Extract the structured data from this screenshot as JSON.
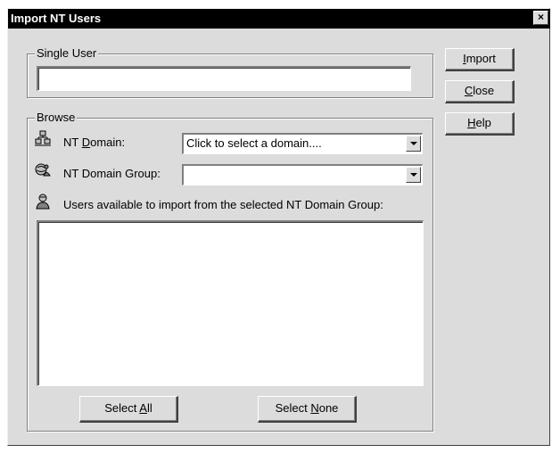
{
  "window": {
    "title": "Import NT Users",
    "close_symbol": "×"
  },
  "single_user": {
    "group_label": "Single User",
    "value": ""
  },
  "browse": {
    "group_label": "Browse",
    "domain_label_pre": "NT ",
    "domain_label_mnemonic": "D",
    "domain_label_post": "omain:",
    "domain_value": "Click to select a domain....",
    "group_label_text": "NT Domain Group:",
    "group_value": "",
    "users_label": "Users available to import from the selected NT Domain Group:",
    "users_list": []
  },
  "buttons": {
    "import": {
      "mnemonic": "I",
      "rest": "mport"
    },
    "close": {
      "mnemonic": "C",
      "rest": "lose"
    },
    "help": {
      "mnemonic": "H",
      "rest": "elp"
    },
    "select_all": {
      "pre": "Select ",
      "mnemonic": "A",
      "rest": "ll"
    },
    "select_none": {
      "pre": "Select ",
      "mnemonic": "N",
      "rest": "one"
    }
  },
  "icons": {
    "domain": "domain-network-icon",
    "group": "domain-group-icon",
    "users": "user-icon"
  }
}
